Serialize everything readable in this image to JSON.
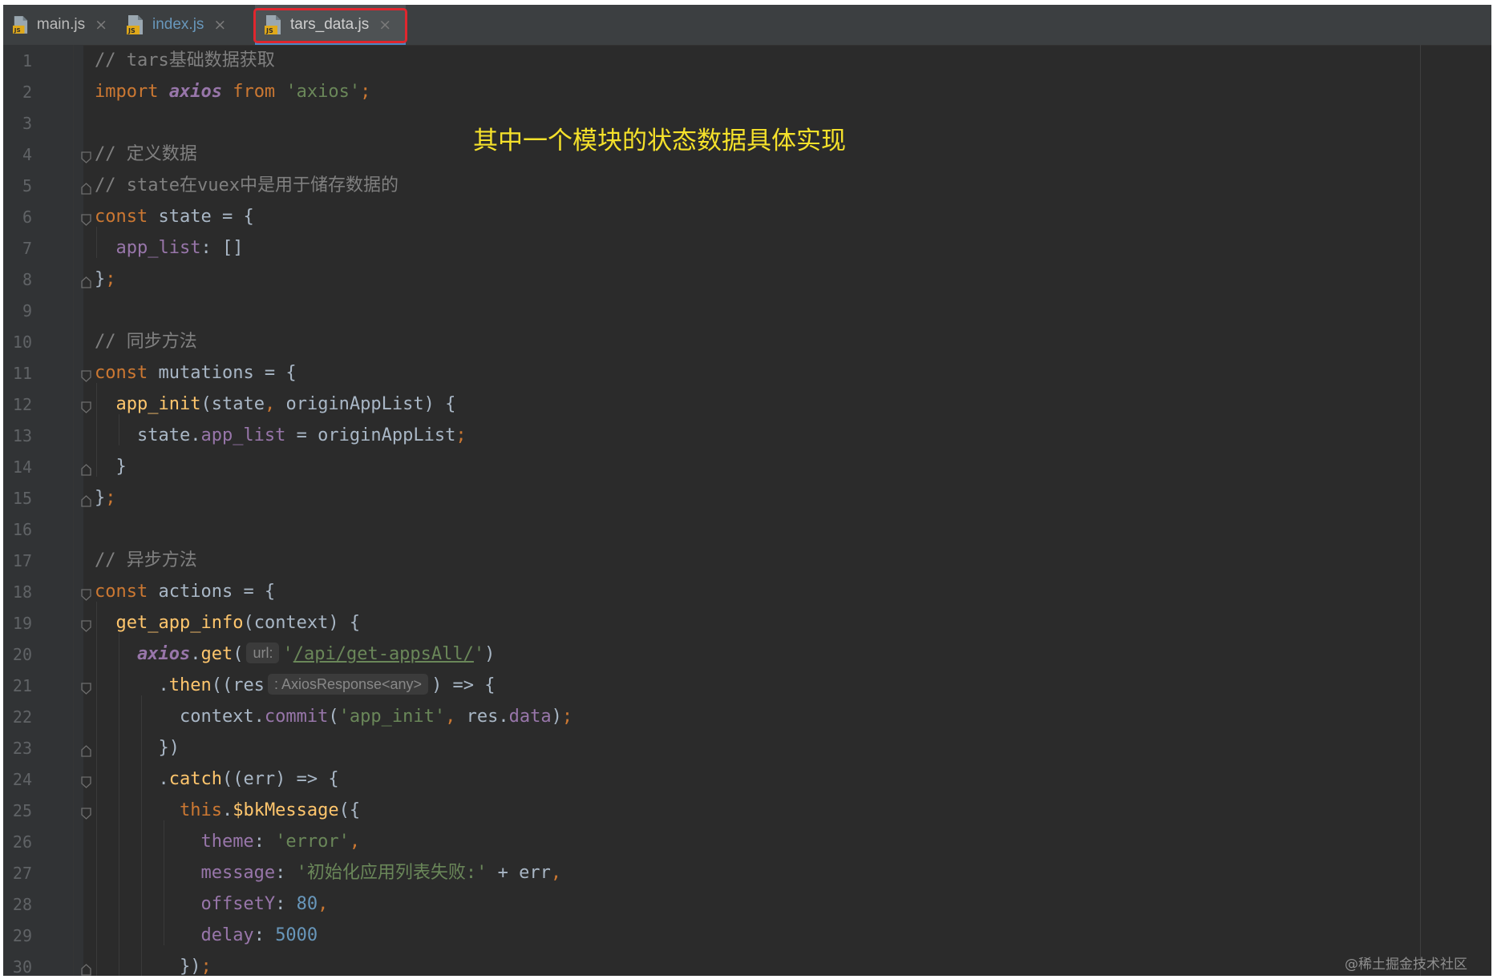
{
  "tabs": [
    {
      "label": "main.js",
      "icon": "js-file-icon",
      "color": "#bbbbbb"
    },
    {
      "label": "index.js",
      "icon": "js-file-icon",
      "color": "#6897bb"
    },
    {
      "label": "tars_data.js",
      "icon": "js-file-icon",
      "color": "#cfcfcf",
      "active": true
    }
  ],
  "tab_close_glyph": "×",
  "annotation": "其中一个模块的状态数据具体实现",
  "watermark": "@稀土掘金技术社区",
  "colors": {
    "editor_bg": "#2b2b2b",
    "keyword": "#cc7832",
    "string": "#6a8759",
    "comment": "#808080",
    "function": "#ffc66d",
    "property": "#9876aa",
    "number": "#6897bb",
    "annotation": "#f5e12b",
    "tab_highlight": "#e0262e"
  },
  "code_lines": [
    {
      "n": "1",
      "text": "// tars基础数据获取"
    },
    {
      "n": "2",
      "text": "import axios from 'axios';"
    },
    {
      "n": "3",
      "text": ""
    },
    {
      "n": "4",
      "text": "// 定义数据"
    },
    {
      "n": "5",
      "text": "// state在vuex中是用于储存数据的"
    },
    {
      "n": "6",
      "text": "const state = {"
    },
    {
      "n": "7",
      "text": "  app_list: []"
    },
    {
      "n": "8",
      "text": "};"
    },
    {
      "n": "9",
      "text": ""
    },
    {
      "n": "10",
      "text": "// 同步方法"
    },
    {
      "n": "11",
      "text": "const mutations = {"
    },
    {
      "n": "12",
      "text": "  app_init(state, originAppList) {"
    },
    {
      "n": "13",
      "text": "    state.app_list = originAppList;"
    },
    {
      "n": "14",
      "text": "  }"
    },
    {
      "n": "15",
      "text": "};"
    },
    {
      "n": "16",
      "text": ""
    },
    {
      "n": "17",
      "text": "// 异步方法"
    },
    {
      "n": "18",
      "text": "const actions = {"
    },
    {
      "n": "19",
      "text": "  get_app_info(context) {"
    },
    {
      "n": "20",
      "text": "    axios.get( url: '/api/get-appsAll/')"
    },
    {
      "n": "21",
      "text": "      .then((res : AxiosResponse<any> ) => {"
    },
    {
      "n": "22",
      "text": "        context.commit('app_init', res.data);"
    },
    {
      "n": "23",
      "text": "      })"
    },
    {
      "n": "24",
      "text": "      .catch((err) => {"
    },
    {
      "n": "25",
      "text": "        this.$bkMessage({"
    },
    {
      "n": "26",
      "text": "          theme: 'error',"
    },
    {
      "n": "27",
      "text": "          message: '初始化应用列表失败:' + err,"
    },
    {
      "n": "28",
      "text": "          offsetY: 80,"
    },
    {
      "n": "29",
      "text": "          delay: 5000"
    },
    {
      "n": "30",
      "text": "        });"
    }
  ],
  "inlay_hints": {
    "line20": "url:",
    "line21": ": AxiosResponse<any>"
  }
}
